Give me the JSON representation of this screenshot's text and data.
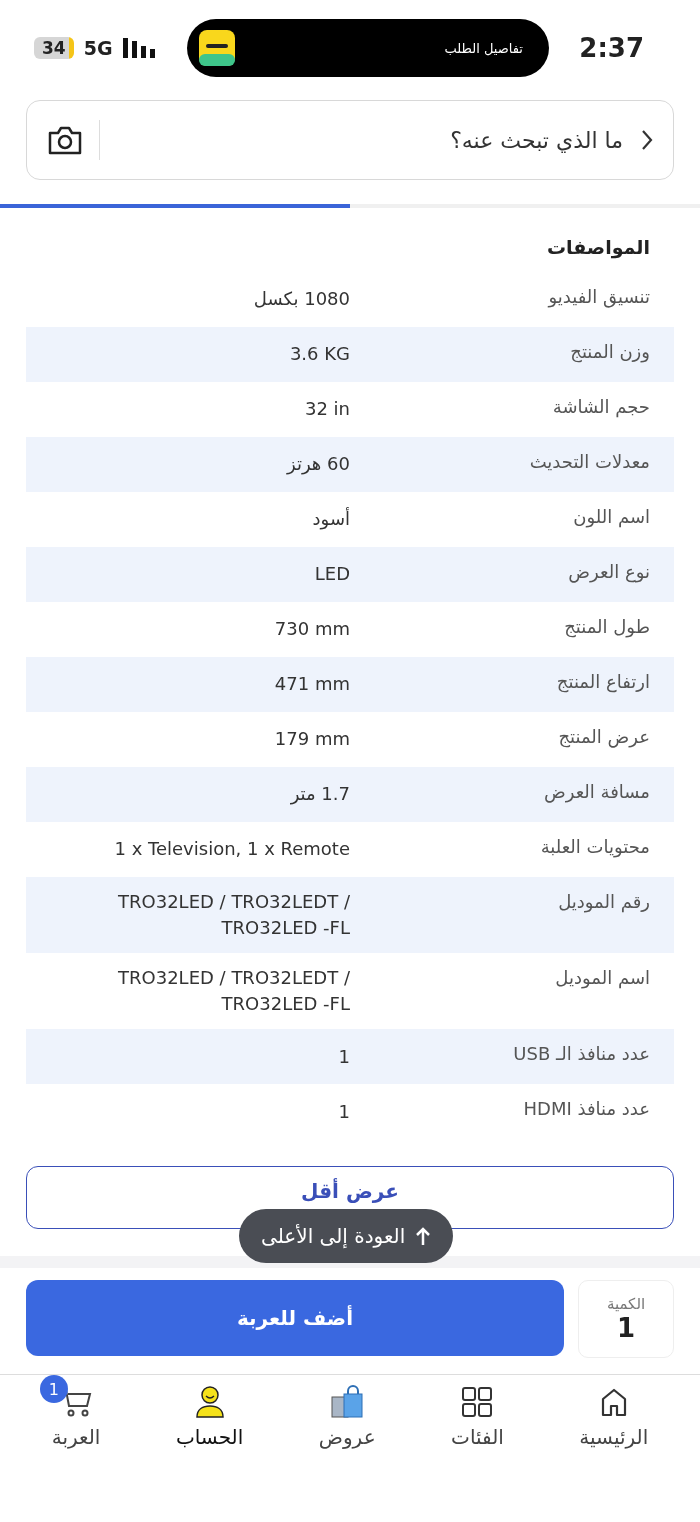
{
  "status_bar": {
    "time": "2:37",
    "activity": "تفاصيل الطلب",
    "network": "5G",
    "battery": "34"
  },
  "search": {
    "placeholder": "ما الذي تبحث عنه؟"
  },
  "section_progress": {
    "level": 0.5
  },
  "specs": {
    "title": "المواصفات",
    "rows": [
      {
        "label": "تنسيق الفيديو",
        "value": "1080 بكسل"
      },
      {
        "label": "وزن المنتج",
        "value": "3.6 KG"
      },
      {
        "label": "حجم الشاشة",
        "value": "32 in"
      },
      {
        "label": "معدلات التحديث",
        "value": "60 هرتز"
      },
      {
        "label": "اسم اللون",
        "value": "أسود"
      },
      {
        "label": "نوع العرض",
        "value": "LED"
      },
      {
        "label": "طول المنتج",
        "value": "730 mm"
      },
      {
        "label": "ارتفاع المنتج",
        "value": "471 mm"
      },
      {
        "label": "عرض المنتج",
        "value": "179 mm"
      },
      {
        "label": "مسافة العرض",
        "value": "1.7 متر"
      },
      {
        "label": "محتويات العلبة",
        "value": "1 x Television, 1 x Remote"
      },
      {
        "label": "رقم الموديل",
        "value": "TRO32LED / TRO32LEDT / TRO32LED -FL"
      },
      {
        "label": "اسم الموديل",
        "value": "TRO32LED / TRO32LEDT / TRO32LED -FL"
      },
      {
        "label": "عدد منافذ الـ USB",
        "value": "1"
      },
      {
        "label": "عدد منافذ HDMI",
        "value": "1"
      }
    ]
  },
  "show_less": "عرض أقل",
  "back_to_top": "العودة إلى الأعلى",
  "quantity": {
    "label": "الكمية",
    "value": "1"
  },
  "add_to_cart": "أضف للعربة",
  "nav": [
    {
      "kind": "home",
      "label": "الرئيسية",
      "selected": false
    },
    {
      "kind": "categories",
      "label": "الفئات",
      "selected": false
    },
    {
      "kind": "offers",
      "label": "عروض",
      "selected": false
    },
    {
      "kind": "account",
      "label": "الحساب",
      "selected": true
    },
    {
      "kind": "cart",
      "label": "العربة",
      "selected": false,
      "badge": "1"
    }
  ]
}
